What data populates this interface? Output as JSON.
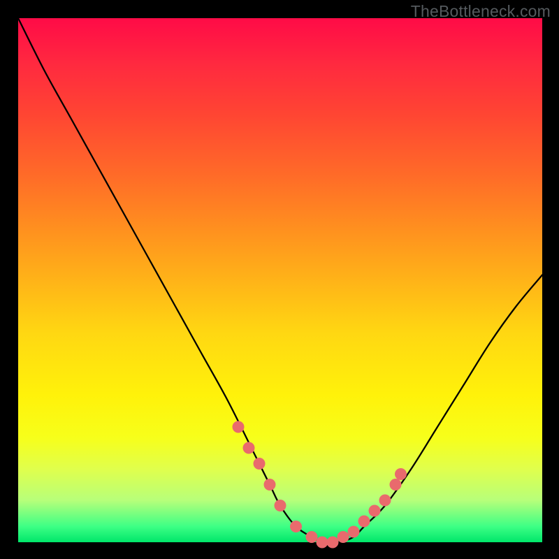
{
  "watermark": "TheBottleneck.com",
  "colors": {
    "background": "#000000",
    "curve": "#000000",
    "marker": "#e96a6d",
    "gradient_stops": [
      "#ff0b47",
      "#ff2a3f",
      "#ff4433",
      "#ff6b28",
      "#ff8f1f",
      "#ffb318",
      "#ffd712",
      "#fff20a",
      "#f7ff1a",
      "#e0ff4c",
      "#b7ff7a",
      "#3dff85",
      "#00e66a"
    ]
  },
  "chart_data": {
    "type": "line",
    "title": "",
    "xlabel": "",
    "ylabel": "",
    "xlim": [
      0,
      100
    ],
    "ylim": [
      0,
      100
    ],
    "grid": false,
    "legend": false,
    "series": [
      {
        "name": "bottleneck-curve",
        "x": [
          0,
          5,
          10,
          15,
          20,
          25,
          30,
          35,
          40,
          45,
          48,
          50,
          53,
          56,
          58,
          61,
          64,
          66,
          70,
          75,
          80,
          85,
          90,
          95,
          100
        ],
        "y": [
          100,
          90,
          81,
          72,
          63,
          54,
          45,
          36,
          27,
          17,
          11,
          7,
          3,
          1,
          0,
          0,
          1,
          3,
          7,
          14,
          22,
          30,
          38,
          45,
          51
        ]
      }
    ],
    "markers": {
      "name": "sample-points",
      "x": [
        42,
        44,
        46,
        48,
        50,
        53,
        56,
        58,
        60,
        62,
        64,
        66,
        68,
        70,
        72,
        73
      ],
      "y": [
        22,
        18,
        15,
        11,
        7,
        3,
        1,
        0,
        0,
        1,
        2,
        4,
        6,
        8,
        11,
        13
      ]
    }
  }
}
